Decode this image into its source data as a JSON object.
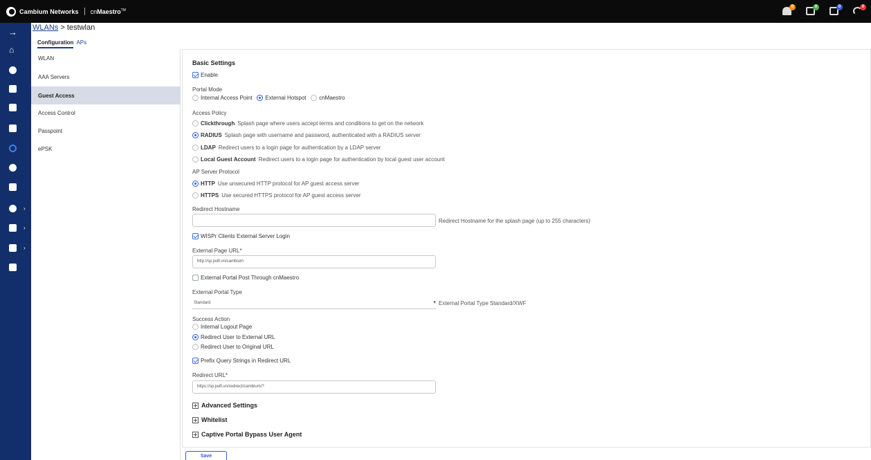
{
  "app": {
    "company": "Cambium Networks",
    "product_prefix": "cn",
    "product_name": "Maestro",
    "trademark": "TM"
  },
  "notifications": [
    {
      "icon": "bell-alerts-icon",
      "count": "0",
      "color": "#f28c00"
    },
    {
      "icon": "events-icon",
      "count": "0",
      "color": "#4caf50"
    },
    {
      "icon": "jobs-icon",
      "count": "0",
      "color": "#3a5bd9"
    },
    {
      "icon": "sync-icon",
      "count": "0",
      "color": "#e53935"
    }
  ],
  "breadcrumb": {
    "parent": "WLANs",
    "separator": " > ",
    "current": "testwlan"
  },
  "tabs": [
    "Configuration",
    "APs"
  ],
  "subnav": [
    "WLAN",
    "AAA Servers",
    "Guest Access",
    "Access Control",
    "Passpoint",
    "ePSK"
  ],
  "form": {
    "basic_settings": "Basic Settings",
    "enable": "Enable",
    "portal_mode": {
      "label": "Portal Mode",
      "options": [
        "Internal Access Point",
        "External Hotspot",
        "cnMaestro"
      ],
      "selected": "External Hotspot"
    },
    "access_policy": {
      "label": "Access Policy",
      "options": [
        {
          "name": "Clickthrough",
          "desc": "Splash page where users accept terms and conditions to get on the network"
        },
        {
          "name": "RADIUS",
          "desc": "Splash page with username and password, authenticated with a RADIUS server"
        },
        {
          "name": "LDAP",
          "desc": "Redirect users to a login page for authentication by a LDAP server"
        },
        {
          "name": "Local Guest Account",
          "desc": "Redirect users to a login page for authentication by local guest user account"
        }
      ],
      "selected": "RADIUS"
    },
    "ap_server_protocol": {
      "label": "AP Server Protocol",
      "options": [
        {
          "name": "HTTP",
          "desc": "Use unsecured HTTP protocol for AP guest access server"
        },
        {
          "name": "HTTPS",
          "desc": "Use secured HTTPS protocol for AP guest access server"
        }
      ],
      "selected": "HTTP"
    },
    "redirect_hostname": {
      "label": "Redirect Hostname",
      "value": "",
      "hint": "Redirect Hostname for the splash page (up to 255 characters)"
    },
    "wispr": "WISPr Clients External Server Login",
    "external_page_url": {
      "label": "External Page URL*",
      "value": "http://sp.jwifi.vn/cambium"
    },
    "external_portal_post": "External Portal Post Through cnMaestro",
    "external_portal_type": {
      "label": "External Portal Type",
      "value": "Standard",
      "hint": "External Portal Type Standard/XWF"
    },
    "success_action": {
      "label": "Success Action",
      "options": [
        "Internal Logout Page",
        "Redirect User to External URL",
        "Redirect User to Original URL"
      ],
      "selected": "Redirect User to External URL"
    },
    "prefix_query": "Prefix Query Strings in Redirect URL",
    "redirect_url": {
      "label": "Redirect URL*",
      "value": "https://sp.jwifi.vn/redirect/cambium/?"
    },
    "advanced_settings": "Advanced Settings",
    "whitelist": "Whitelist",
    "captive_bypass": "Captive Portal Bypass User Agent"
  },
  "save_label": "Save"
}
